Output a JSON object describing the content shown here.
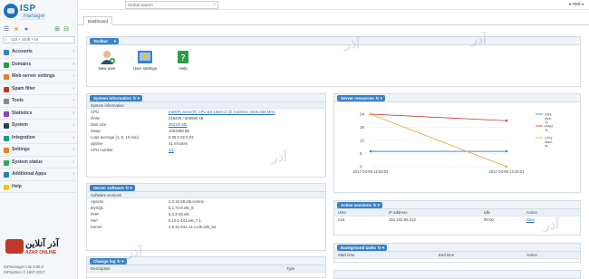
{
  "app": {
    "logo_name": "ISP",
    "logo_sub": "manager"
  },
  "sidebar": {
    "search_placeholder": "Ctrl + Shift + M",
    "items": [
      {
        "label": "Accounts",
        "icon": "accounts-icon",
        "color": "#3a82c8"
      },
      {
        "label": "Domains",
        "icon": "domains-icon",
        "color": "#2f9b4a"
      },
      {
        "label": "Web-server settings",
        "icon": "web-server-icon",
        "color": "#d9822b"
      },
      {
        "label": "Spam filter",
        "icon": "spam-filter-icon",
        "color": "#c0392b"
      },
      {
        "label": "Tools",
        "icon": "tools-icon",
        "color": "#7f8c8d"
      },
      {
        "label": "Statistics",
        "icon": "statistics-icon",
        "color": "#8e44ad"
      },
      {
        "label": "System",
        "icon": "system-icon",
        "color": "#2c3e50"
      },
      {
        "label": "Integration",
        "icon": "integration-icon",
        "color": "#16a085"
      },
      {
        "label": "Settings",
        "icon": "settings-icon",
        "color": "#e67e22"
      },
      {
        "label": "System status",
        "icon": "system-status-icon",
        "color": "#27ae60"
      },
      {
        "label": "Additional Apps",
        "icon": "additional-apps-icon",
        "color": "#2980b9"
      },
      {
        "label": "Help",
        "icon": "help-icon",
        "color": "#f1c40f"
      }
    ],
    "footer_line1": "ISPmanager Lite 5.95.0",
    "footer_line2": "ISPsystem © 1997-2017"
  },
  "topbar": {
    "search_placeholder": "Global search",
    "user": "root"
  },
  "tabs": {
    "dashboard": "Dashboard"
  },
  "toolbar": {
    "title": "Toolbar",
    "buttons": [
      {
        "label": "New user"
      },
      {
        "label": "User settings"
      },
      {
        "label": "Help"
      }
    ]
  },
  "system_info": {
    "title": "System information",
    "subheader": "System information",
    "rows": [
      {
        "key": "CPU",
        "value": "Intel(R) Xeon(R) CPU E5-1650 v2 @ 3.50GHz 3400.938 MHz",
        "link": true
      },
      {
        "key": "RAM",
        "value": "218228 / 508580 kB",
        "link": false
      },
      {
        "key": "Disk size",
        "value": "3631/0 Mb",
        "link": true
      },
      {
        "key": "Swap",
        "value": "1003388 kB",
        "link": false
      },
      {
        "key": "Load average (1, 5, 15 min)",
        "value": "0.08 0.02 0.03",
        "link": false
      },
      {
        "key": "Uptime",
        "value": "41 minutes",
        "link": false
      },
      {
        "key": "CPU number",
        "value": "1/1",
        "link": true
      }
    ]
  },
  "server_software": {
    "title": "Server software",
    "subheader": "Software versions",
    "rows": [
      {
        "key": "Apache",
        "value": "2.2.15-59.el6.centos"
      },
      {
        "key": "MySQL",
        "value": "5.1.73-8.el6_8"
      },
      {
        "key": "PHP",
        "value": "5.3.3-49.el6"
      },
      {
        "key": "Perl",
        "value": "5.10.1-141.el6_7.1"
      },
      {
        "key": "Kernel",
        "value": "2.6.32-642.13.1.el6.x86_64"
      }
    ]
  },
  "change_log": {
    "title": "Change log",
    "columns": [
      "Description",
      "Type"
    ]
  },
  "server_resources": {
    "title": "Server resources"
  },
  "active_sessions": {
    "title": "Active sessions",
    "columns": [
      "User",
      "IP address",
      "Idle",
      "Action"
    ],
    "rows": [
      {
        "user": "root",
        "ip": "151.242.65.212",
        "idle": "00:00",
        "action": "Stop"
      }
    ]
  },
  "background_tasks": {
    "title": "Background tasks",
    "columns": [
      "Start time",
      "End time",
      "Action"
    ]
  },
  "chart_data": {
    "type": "line",
    "x": [
      "2017-04-08 12:53:02",
      "2017-04-08 14:10:01"
    ],
    "y_ticks": [
      0,
      6,
      12,
      18,
      24
    ],
    "ylim": [
      0,
      24
    ],
    "series": [
      {
        "name": "Disk size, %",
        "values": [
          7,
          7
        ],
        "color": "#3a6fd8"
      },
      {
        "name": "RAM, %",
        "values": [
          24,
          21
        ],
        "color": "#c0392b"
      },
      {
        "name": "CPU load, %",
        "values": [
          24,
          0
        ],
        "color": "#e6a23c"
      }
    ],
    "legend": "right"
  },
  "colors": {
    "accent": "#3a82c8",
    "panel_header": "#eef3f9"
  }
}
